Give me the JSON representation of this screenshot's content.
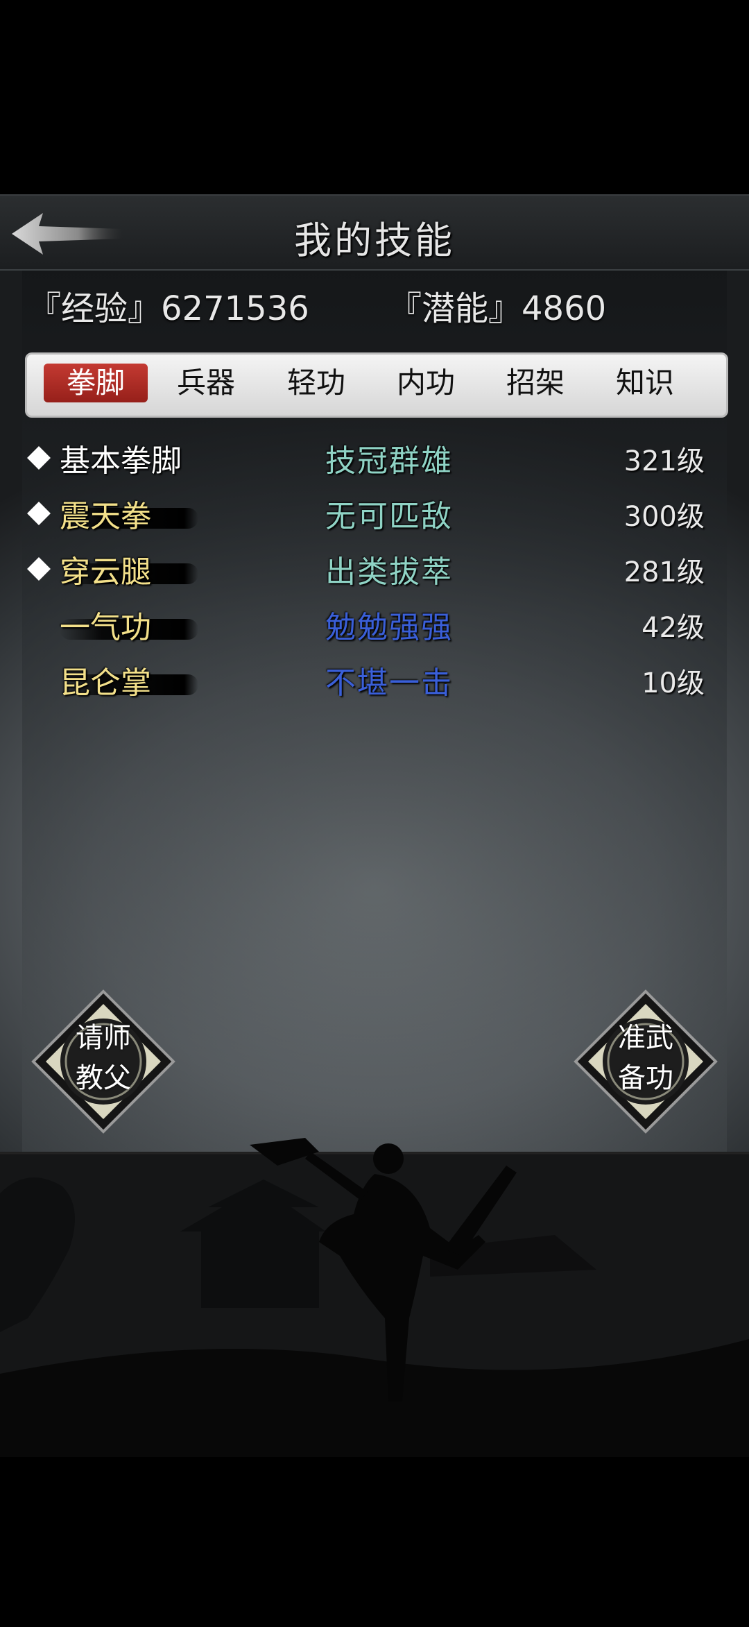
{
  "header": {
    "title": "我的技能",
    "back_icon": "back-arrow-icon"
  },
  "stats": {
    "experience": "『经验』6271536",
    "potential": "『潜能』4860"
  },
  "tabs": [
    {
      "label": "拳脚",
      "active": true
    },
    {
      "label": "兵器",
      "active": false
    },
    {
      "label": "轻功",
      "active": false
    },
    {
      "label": "内功",
      "active": false
    },
    {
      "label": "招架",
      "active": false
    },
    {
      "label": "知识",
      "active": false
    }
  ],
  "skills": [
    {
      "name": "基本拳脚",
      "rank": "技冠群雄",
      "level": "321级",
      "marked": true,
      "name_color": "#ffffff",
      "rank_color": "#8fd3c5"
    },
    {
      "name": "震天拳",
      "rank": "无可匹敌",
      "level": "300级",
      "marked": true,
      "name_color": "#f3e08a",
      "rank_color": "#8fd3c5"
    },
    {
      "name": "穿云腿",
      "rank": "出类拔萃",
      "level": "281级",
      "marked": true,
      "name_color": "#f3e08a",
      "rank_color": "#8fd3c5"
    },
    {
      "name": "一气功",
      "rank": "勉勉强强",
      "level": "42级",
      "marked": false,
      "name_color": "#f3e08a",
      "rank_color": "#3a5fd8"
    },
    {
      "name": "昆仑掌",
      "rank": "不堪一击",
      "level": "10级",
      "marked": false,
      "name_color": "#f3e08a",
      "rank_color": "#3a5fd8"
    }
  ],
  "buttons": {
    "ask_master": "请师\n教父",
    "prepare_skill": "准武\n备功"
  }
}
